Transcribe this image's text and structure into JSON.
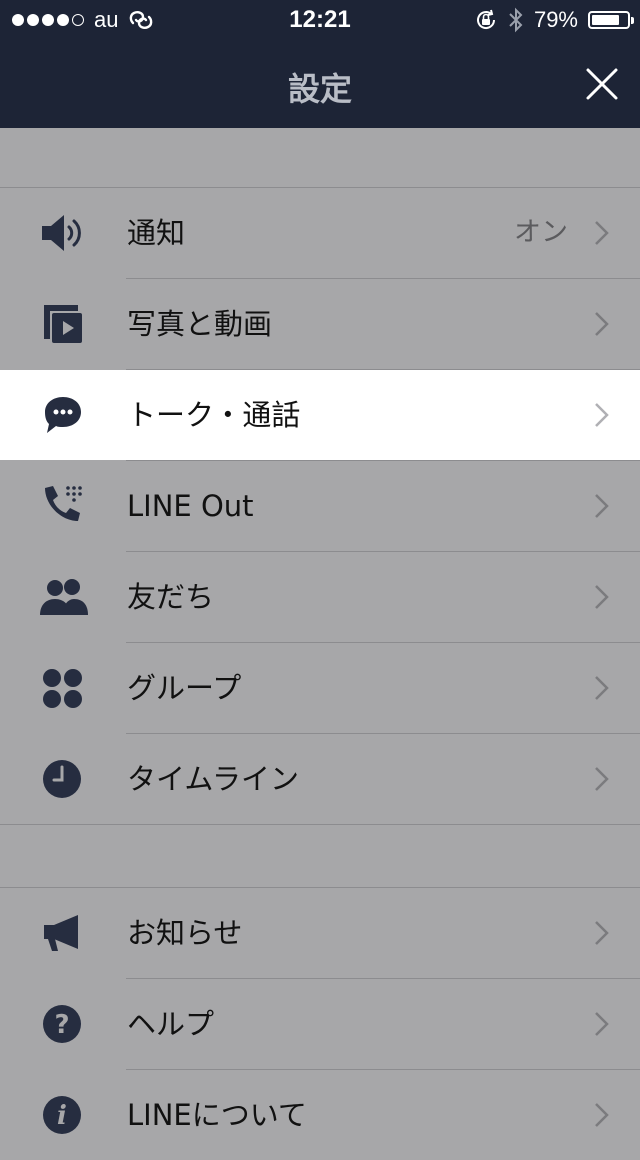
{
  "status_bar": {
    "carrier": "au",
    "time": "12:21",
    "battery_text": "79%",
    "battery_level": 0.79
  },
  "nav": {
    "title": "設定",
    "close_icon": "close-icon"
  },
  "sections": [
    {
      "items": [
        {
          "icon": "speaker-icon",
          "label": "通知",
          "value": "オン"
        },
        {
          "icon": "photo-video-icon",
          "label": "写真と動画"
        },
        {
          "icon": "chat-bubble-icon",
          "label": "トーク・通話",
          "selected": true
        },
        {
          "icon": "phone-icon",
          "label": "LINE Out"
        },
        {
          "icon": "friends-icon",
          "label": "友だち"
        },
        {
          "icon": "group-icon",
          "label": "グループ"
        },
        {
          "icon": "clock-icon",
          "label": "タイムライン"
        }
      ]
    },
    {
      "items": [
        {
          "icon": "megaphone-icon",
          "label": "お知らせ"
        },
        {
          "icon": "help-icon",
          "label": "ヘルプ"
        },
        {
          "icon": "info-icon",
          "label": "LINEについて"
        }
      ]
    }
  ],
  "colors": {
    "navbar": "#1d2436",
    "background": "#a7a7a9",
    "selected_row": "#ffffff",
    "icon": "#262d40"
  }
}
